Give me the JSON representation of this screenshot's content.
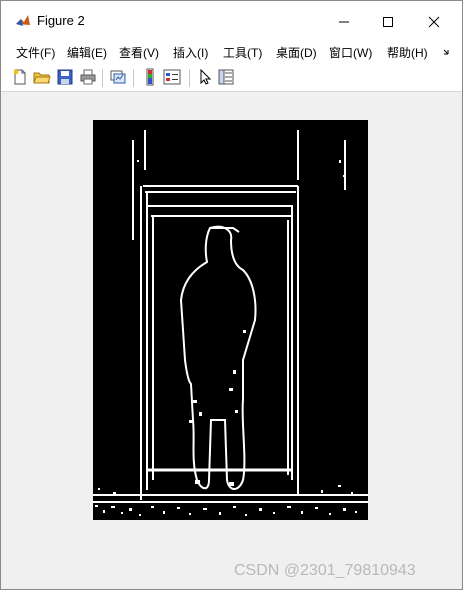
{
  "window": {
    "title": "Figure 2"
  },
  "title_buttons": {
    "minimize": "—",
    "maximize": "□",
    "close": "✕"
  },
  "menu": [
    "文件(F)",
    "编辑(E)",
    "查看(V)",
    "插入(I)",
    "工具(T)",
    "桌面(D)",
    "窗口(W)",
    "帮助(H)"
  ],
  "menu_overflow_icon": "chevron-right-icon",
  "toolbar_icons": [
    "new-figure-icon",
    "open-file-icon",
    "save-icon",
    "print-icon",
    "link-plot-icon",
    "insert-colorbar-icon",
    "insert-legend-icon",
    "pointer-icon",
    "property-inspector-icon"
  ],
  "image": {
    "description_icon": "edge-detected-image"
  },
  "watermark": "CSDN @2301_79810943"
}
